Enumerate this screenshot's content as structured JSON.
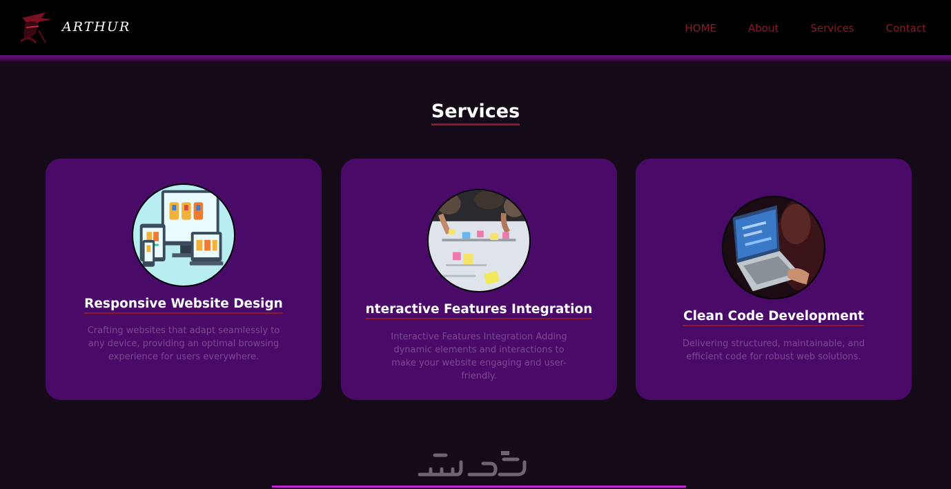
{
  "brand": {
    "name": "ARTHUR"
  },
  "nav": {
    "items": [
      {
        "label": "HOME"
      },
      {
        "label": "About"
      },
      {
        "label": "Services"
      },
      {
        "label": "Contact"
      }
    ]
  },
  "services": {
    "title": "Services",
    "cards": [
      {
        "title": "Responsive Website Design",
        "description": "Crafting websites that adapt seamlessly to any device, providing an optimal browsing experience for users everywhere.",
        "image": "responsive-devices-image"
      },
      {
        "title": "nteractive Features Integration",
        "description": "Interactive Features Integration Adding dynamic elements and interactions to make your website engaging and user-friendly.",
        "image": "sticky-notes-planning-image"
      },
      {
        "title": "Clean Code Development",
        "description": "Delivering structured, maintainable, and efficient code for robust web solutions.",
        "image": "laptop-coding-image"
      }
    ]
  },
  "watermark": {
    "text": "خمسات"
  },
  "colors": {
    "background": "#140a18",
    "header": "#000000",
    "card": "#4a0b68",
    "accent_underline": "#8a1a2c",
    "nav_link": "#8a1a2c",
    "bottom_line": "#c026d3"
  }
}
